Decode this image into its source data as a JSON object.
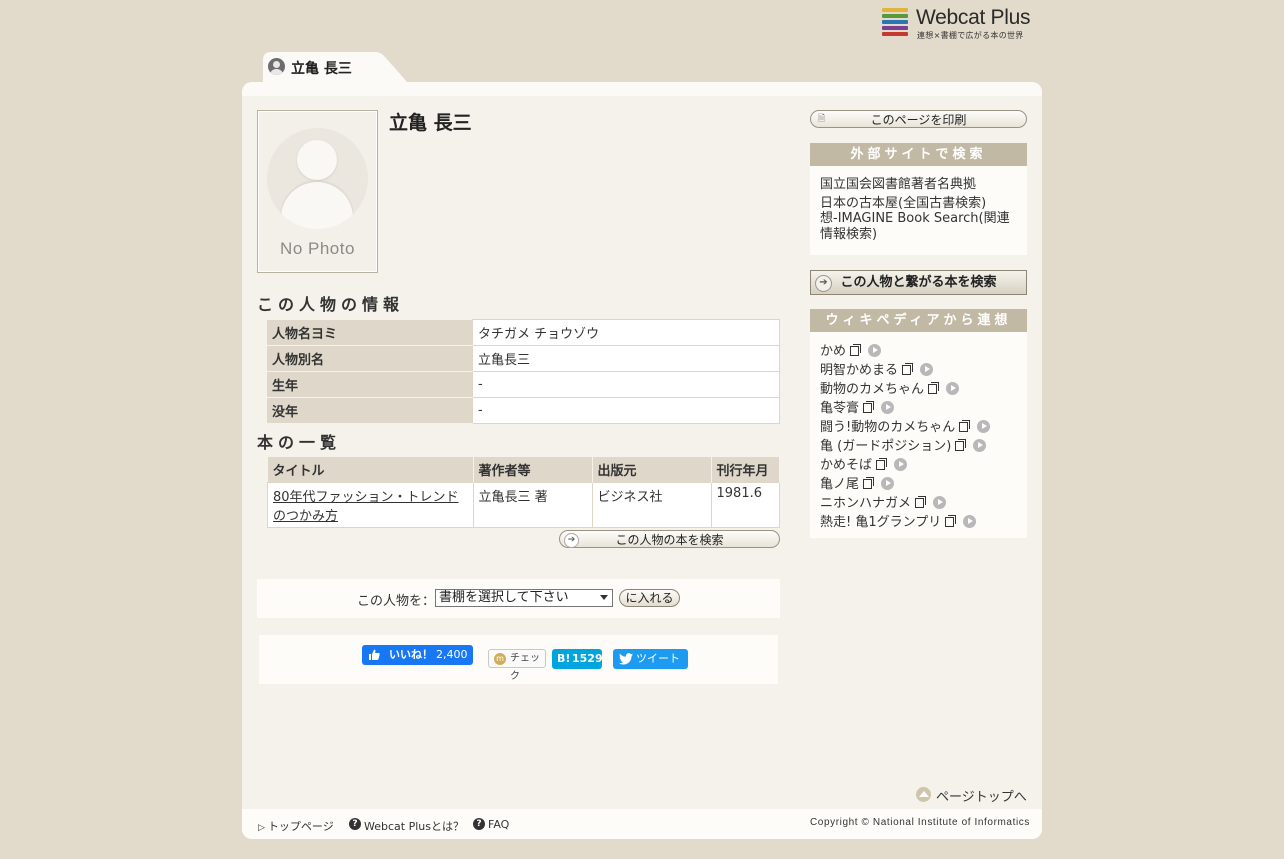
{
  "brand": {
    "name": "Webcat Plus",
    "tagline": "連想×書棚で広がる本の世界",
    "bar_colors": [
      "#e2b43b",
      "#5a9a3a",
      "#2d74b3",
      "#7a3f93",
      "#c23b2e"
    ]
  },
  "tab": {
    "label": "立亀 長三"
  },
  "person": {
    "name": "立亀 長三",
    "photo_text": "No Photo"
  },
  "info_section": {
    "title": "この人物の情報",
    "rows": [
      {
        "label": "人物名ヨミ",
        "value": "タチガメ チョウゾウ"
      },
      {
        "label": "人物別名",
        "value": "立亀長三"
      },
      {
        "label": "生年",
        "value": "-"
      },
      {
        "label": "没年",
        "value": "-"
      }
    ]
  },
  "books_section": {
    "title": "本の一覧",
    "columns": [
      "タイトル",
      "著作者等",
      "出版元",
      "刊行年月"
    ],
    "rows": [
      {
        "title": "80年代ファッション・トレンドのつかみ方",
        "author": "立亀長三 著",
        "publisher": "ビジネス社",
        "date": "1981.6"
      }
    ],
    "search_button": "この人物の本を検索"
  },
  "shelf": {
    "label": "この人物を：",
    "select_value": "書棚を選択して下さい",
    "submit": "に入れる"
  },
  "social": {
    "fb_label": "いいね！",
    "fb_count": "2,400",
    "mixi_label": "チェック",
    "hatena_mark": "B!",
    "hatena_count": "1529",
    "tweet_label": "ツイート"
  },
  "sidebar": {
    "print_button": "このページを印刷",
    "external_title": "外部サイトで検索",
    "external_links": [
      "国立国会図書館著者名典拠",
      "日本の古本屋(全国古書検索)",
      "想-IMAGINE Book Search(関連情報検索)"
    ],
    "connect_button": "この人物と繋がる本を検索",
    "wiki_title": "ウィキペディアから連想",
    "wiki_items": [
      "かめ",
      "明智かめまる",
      "動物のカメちゃん",
      "亀苓膏",
      "闘う!動物のカメちゃん",
      "亀 (ガードポジション)",
      "かめそば",
      "亀ノ尾",
      "ニホンハナガメ",
      "熱走! 亀1グランプリ"
    ]
  },
  "pagetop": "ページトップへ",
  "footer": {
    "links": [
      "トップページ",
      "Webcat Plusとは？",
      "FAQ"
    ],
    "copyright": "Copyright © National Institute of Informatics"
  }
}
